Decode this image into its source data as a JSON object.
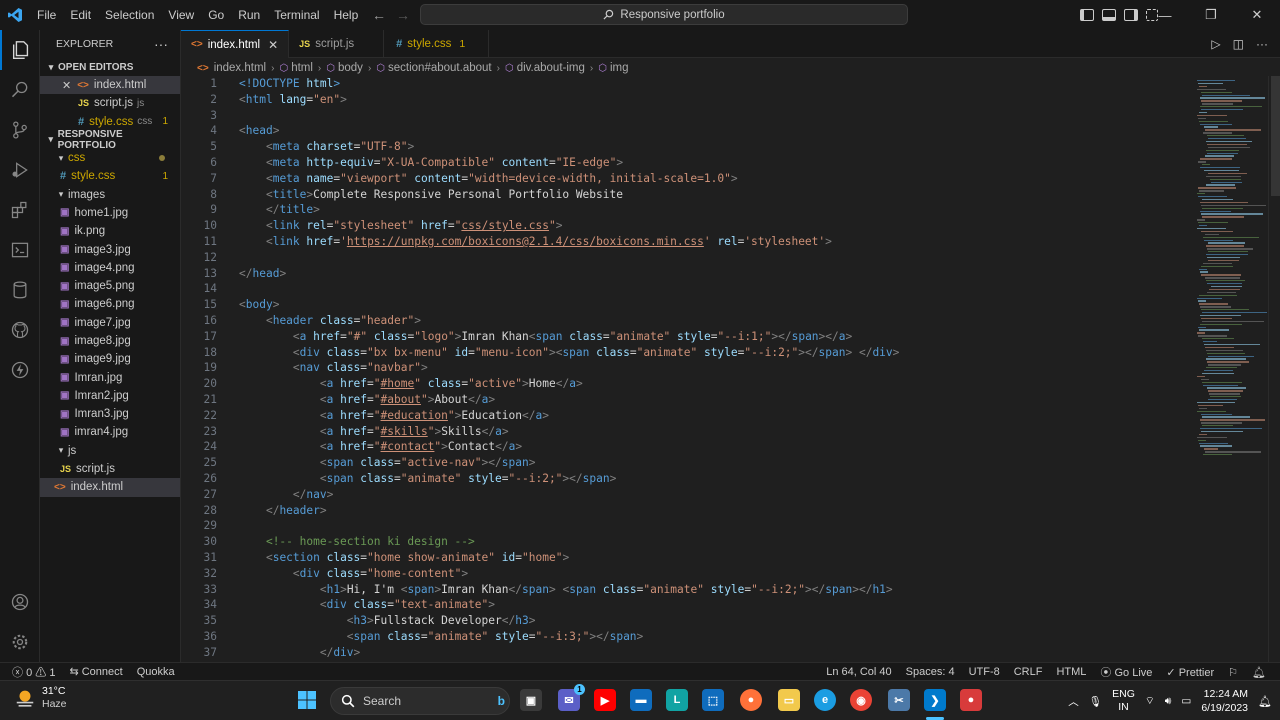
{
  "titlebar": {
    "menu": [
      "File",
      "Edit",
      "Selection",
      "View",
      "Go",
      "Run",
      "Terminal",
      "Help"
    ],
    "search_text": "Responsive portfolio"
  },
  "sidebar": {
    "title": "EXPLORER",
    "open_editors_label": "OPEN EDITORS",
    "open_editors": [
      {
        "name": "index.html",
        "kind": "html",
        "hint": ""
      },
      {
        "name": "script.js",
        "kind": "js",
        "hint": "js"
      },
      {
        "name": "style.css",
        "kind": "css",
        "hint": "css",
        "badge": "1"
      }
    ],
    "project_label": "RESPONSIVE PORTFOLIO",
    "folders": {
      "css": "css",
      "images": "images",
      "js": "js"
    },
    "css_files": [
      {
        "name": "style.css",
        "badge": "1"
      }
    ],
    "image_files": [
      "home1.jpg",
      "ik.png",
      "image3.jpg",
      "image4.png",
      "image5.png",
      "image6.png",
      "image7.jpg",
      "image8.jpg",
      "image9.jpg",
      "Imran.jpg",
      "Imran2.jpg",
      "Imran3.jpg",
      "imran4.jpg"
    ],
    "js_files": [
      "script.js"
    ],
    "root_files": [
      "index.html"
    ]
  },
  "tabs": [
    {
      "label": "index.html",
      "kind": "html",
      "active": true
    },
    {
      "label": "script.js",
      "kind": "js",
      "active": false
    },
    {
      "label": "style.css",
      "kind": "css",
      "active": false,
      "badge": "1"
    }
  ],
  "breadcrumb": [
    "index.html",
    "html",
    "body",
    "section#about.about",
    "div.about-img",
    "img"
  ],
  "code_lines": [
    {
      "n": 1,
      "i": 0,
      "h": "<span class=\"t\">&lt;!DOCTYPE</span> <span class=\"a\">html</span><span class=\"t\">&gt;</span>"
    },
    {
      "n": 2,
      "i": 0,
      "h": "<span class=\"p\">&lt;</span><span class=\"t\">html</span> <span class=\"a\">lang</span>=<span class=\"s\">\"en\"</span><span class=\"p\">&gt;</span>"
    },
    {
      "n": 3,
      "i": 0,
      "h": ""
    },
    {
      "n": 4,
      "i": 0,
      "h": "<span class=\"p\">&lt;</span><span class=\"t\">head</span><span class=\"p\">&gt;</span>"
    },
    {
      "n": 5,
      "i": 1,
      "h": "<span class=\"p\">&lt;</span><span class=\"t\">meta</span> <span class=\"a\">charset</span>=<span class=\"s\">\"UTF-8\"</span><span class=\"p\">&gt;</span>"
    },
    {
      "n": 6,
      "i": 1,
      "h": "<span class=\"p\">&lt;</span><span class=\"t\">meta</span> <span class=\"a\">http-equiv</span>=<span class=\"s\">\"X-UA-Compatible\"</span> <span class=\"a\">content</span>=<span class=\"s\">\"IE-edge\"</span><span class=\"p\">&gt;</span>"
    },
    {
      "n": 7,
      "i": 1,
      "h": "<span class=\"p\">&lt;</span><span class=\"t\">meta</span> <span class=\"a\">name</span>=<span class=\"s\">\"viewport\"</span> <span class=\"a\">content</span>=<span class=\"s\">\"width=device-width, initial-scale=1.0\"</span><span class=\"p\">&gt;</span>"
    },
    {
      "n": 8,
      "i": 1,
      "h": "<span class=\"p\">&lt;</span><span class=\"t\">title</span><span class=\"p\">&gt;</span><span class=\"txt\">Complete Responsive Personal Portfolio Website</span>"
    },
    {
      "n": 9,
      "i": 1,
      "h": "<span class=\"p\">&lt;/</span><span class=\"t\">title</span><span class=\"p\">&gt;</span>"
    },
    {
      "n": 10,
      "i": 1,
      "h": "<span class=\"p\">&lt;</span><span class=\"t\">link</span> <span class=\"a\">rel</span>=<span class=\"s\">\"stylesheet\"</span> <span class=\"a\">href</span>=<span class=\"s\">\"<span class=\"u\">css/style.css</span>\"</span><span class=\"p\">&gt;</span>"
    },
    {
      "n": 11,
      "i": 1,
      "h": "<span class=\"p\">&lt;</span><span class=\"t\">link</span> <span class=\"a\">href</span>=<span class=\"s\">'<span class=\"u\">https://unpkg.com/boxicons@2.1.4/css/boxicons.min.css</span>'</span> <span class=\"a\">rel</span>=<span class=\"s\">'stylesheet'</span><span class=\"p\">&gt;</span>"
    },
    {
      "n": 12,
      "i": 0,
      "h": ""
    },
    {
      "n": 13,
      "i": 0,
      "h": "<span class=\"p\">&lt;/</span><span class=\"t\">head</span><span class=\"p\">&gt;</span>"
    },
    {
      "n": 14,
      "i": 0,
      "h": ""
    },
    {
      "n": 15,
      "i": 0,
      "h": "<span class=\"p\">&lt;</span><span class=\"t\">body</span><span class=\"p\">&gt;</span>"
    },
    {
      "n": 16,
      "i": 1,
      "h": "<span class=\"p\">&lt;</span><span class=\"t\">header</span> <span class=\"a\">class</span>=<span class=\"s\">\"header\"</span><span class=\"p\">&gt;</span>"
    },
    {
      "n": 17,
      "i": 2,
      "h": "<span class=\"p\">&lt;</span><span class=\"t\">a</span> <span class=\"a\">href</span>=<span class=\"s\">\"#\"</span> <span class=\"a\">class</span>=<span class=\"s\">\"logo\"</span><span class=\"p\">&gt;</span><span class=\"txt\">Imran Khan</span><span class=\"p\">&lt;</span><span class=\"t\">span</span> <span class=\"a\">class</span>=<span class=\"s\">\"animate\"</span> <span class=\"a\">style</span>=<span class=\"s\">\"--i:1;\"</span><span class=\"p\">&gt;&lt;/</span><span class=\"t\">span</span><span class=\"p\">&gt;&lt;/</span><span class=\"t\">a</span><span class=\"p\">&gt;</span>"
    },
    {
      "n": 18,
      "i": 2,
      "h": "<span class=\"p\">&lt;</span><span class=\"t\">div</span> <span class=\"a\">class</span>=<span class=\"s\">\"bx bx-menu\"</span> <span class=\"a\">id</span>=<span class=\"s\">\"menu-icon\"</span><span class=\"p\">&gt;&lt;</span><span class=\"t\">span</span> <span class=\"a\">class</span>=<span class=\"s\">\"animate\"</span> <span class=\"a\">style</span>=<span class=\"s\">\"--i:2;\"</span><span class=\"p\">&gt;&lt;/</span><span class=\"t\">span</span><span class=\"p\">&gt;</span> <span class=\"p\">&lt;/</span><span class=\"t\">div</span><span class=\"p\">&gt;</span>"
    },
    {
      "n": 19,
      "i": 2,
      "h": "<span class=\"p\">&lt;</span><span class=\"t\">nav</span> <span class=\"a\">class</span>=<span class=\"s\">\"navbar\"</span><span class=\"p\">&gt;</span>"
    },
    {
      "n": 20,
      "i": 3,
      "h": "<span class=\"p\">&lt;</span><span class=\"t\">a</span> <span class=\"a\">href</span>=<span class=\"s\">\"<span class=\"u\">#home</span>\"</span> <span class=\"a\">class</span>=<span class=\"s\">\"active\"</span><span class=\"p\">&gt;</span><span class=\"txt\">Home</span><span class=\"p\">&lt;/</span><span class=\"t\">a</span><span class=\"p\">&gt;</span>"
    },
    {
      "n": 21,
      "i": 3,
      "h": "<span class=\"p\">&lt;</span><span class=\"t\">a</span> <span class=\"a\">href</span>=<span class=\"s\">\"<span class=\"u\">#about</span>\"</span><span class=\"p\">&gt;</span><span class=\"txt\">About</span><span class=\"p\">&lt;/</span><span class=\"t\">a</span><span class=\"p\">&gt;</span>"
    },
    {
      "n": 22,
      "i": 3,
      "h": "<span class=\"p\">&lt;</span><span class=\"t\">a</span> <span class=\"a\">href</span>=<span class=\"s\">\"<span class=\"u\">#education</span>\"</span><span class=\"p\">&gt;</span><span class=\"txt\">Education</span><span class=\"p\">&lt;/</span><span class=\"t\">a</span><span class=\"p\">&gt;</span>"
    },
    {
      "n": 23,
      "i": 3,
      "h": "<span class=\"p\">&lt;</span><span class=\"t\">a</span> <span class=\"a\">href</span>=<span class=\"s\">\"<span class=\"u\">#skills</span>\"</span><span class=\"p\">&gt;</span><span class=\"txt\">Skills</span><span class=\"p\">&lt;/</span><span class=\"t\">a</span><span class=\"p\">&gt;</span>"
    },
    {
      "n": 24,
      "i": 3,
      "h": "<span class=\"p\">&lt;</span><span class=\"t\">a</span> <span class=\"a\">href</span>=<span class=\"s\">\"<span class=\"u\">#contact</span>\"</span><span class=\"p\">&gt;</span><span class=\"txt\">Contact</span><span class=\"p\">&lt;/</span><span class=\"t\">a</span><span class=\"p\">&gt;</span>"
    },
    {
      "n": 25,
      "i": 3,
      "h": "<span class=\"p\">&lt;</span><span class=\"t\">span</span> <span class=\"a\">class</span>=<span class=\"s\">\"active-nav\"</span><span class=\"p\">&gt;&lt;/</span><span class=\"t\">span</span><span class=\"p\">&gt;</span>"
    },
    {
      "n": 26,
      "i": 3,
      "h": "<span class=\"p\">&lt;</span><span class=\"t\">span</span> <span class=\"a\">class</span>=<span class=\"s\">\"animate\"</span> <span class=\"a\">style</span>=<span class=\"s\">\"--i:2;\"</span><span class=\"p\">&gt;&lt;/</span><span class=\"t\">span</span><span class=\"p\">&gt;</span>"
    },
    {
      "n": 27,
      "i": 2,
      "h": "<span class=\"p\">&lt;/</span><span class=\"t\">nav</span><span class=\"p\">&gt;</span>"
    },
    {
      "n": 28,
      "i": 1,
      "h": "<span class=\"p\">&lt;/</span><span class=\"t\">header</span><span class=\"p\">&gt;</span>"
    },
    {
      "n": 29,
      "i": 0,
      "h": ""
    },
    {
      "n": 30,
      "i": 1,
      "h": "<span class=\"c\">&lt;!-- home-section ki design --&gt;</span>"
    },
    {
      "n": 31,
      "i": 1,
      "h": "<span class=\"p\">&lt;</span><span class=\"t\">section</span> <span class=\"a\">class</span>=<span class=\"s\">\"home show-animate\"</span> <span class=\"a\">id</span>=<span class=\"s\">\"home\"</span><span class=\"p\">&gt;</span>"
    },
    {
      "n": 32,
      "i": 2,
      "h": "<span class=\"p\">&lt;</span><span class=\"t\">div</span> <span class=\"a\">class</span>=<span class=\"s\">\"home-content\"</span><span class=\"p\">&gt;</span>"
    },
    {
      "n": 33,
      "i": 3,
      "h": "<span class=\"p\">&lt;</span><span class=\"t\">h1</span><span class=\"p\">&gt;</span><span class=\"txt\">Hi, I'm </span><span class=\"p\">&lt;</span><span class=\"t\">span</span><span class=\"p\">&gt;</span><span class=\"txt\">Imran Khan</span><span class=\"p\">&lt;/</span><span class=\"t\">span</span><span class=\"p\">&gt;</span> <span class=\"p\">&lt;</span><span class=\"t\">span</span> <span class=\"a\">class</span>=<span class=\"s\">\"animate\"</span> <span class=\"a\">style</span>=<span class=\"s\">\"--i:2;\"</span><span class=\"p\">&gt;&lt;/</span><span class=\"t\">span</span><span class=\"p\">&gt;&lt;/</span><span class=\"t\">h1</span><span class=\"p\">&gt;</span>"
    },
    {
      "n": 34,
      "i": 3,
      "h": "<span class=\"p\">&lt;</span><span class=\"t\">div</span> <span class=\"a\">class</span>=<span class=\"s\">\"text-animate\"</span><span class=\"p\">&gt;</span>"
    },
    {
      "n": 35,
      "i": 4,
      "h": "<span class=\"p\">&lt;</span><span class=\"t\">h3</span><span class=\"p\">&gt;</span><span class=\"txt\">Fullstack Developer</span><span class=\"p\">&lt;/</span><span class=\"t\">h3</span><span class=\"p\">&gt;</span>"
    },
    {
      "n": 36,
      "i": 4,
      "h": "<span class=\"p\">&lt;</span><span class=\"t\">span</span> <span class=\"a\">class</span>=<span class=\"s\">\"animate\"</span> <span class=\"a\">style</span>=<span class=\"s\">\"--i:3;\"</span><span class=\"p\">&gt;&lt;/</span><span class=\"t\">span</span><span class=\"p\">&gt;</span>"
    },
    {
      "n": 37,
      "i": 3,
      "h": "<span class=\"p\">&lt;/</span><span class=\"t\">div</span><span class=\"p\">&gt;</span>"
    }
  ],
  "statusbar": {
    "errors": "0",
    "warnings": "1",
    "connect": "Connect",
    "quokka": "Quokka",
    "position": "Ln 64, Col 40",
    "spaces": "Spaces: 4",
    "encoding": "UTF-8",
    "eol": "CRLF",
    "language": "HTML",
    "golive": "Go Live",
    "prettier": "Prettier"
  },
  "taskbar": {
    "temperature": "31°C",
    "condition": "Haze",
    "search_label": "Search",
    "lang_top": "ENG",
    "lang_bottom": "IN",
    "time": "12:24 AM",
    "date": "6/19/2023",
    "chat_badge": "1"
  },
  "colors": {
    "accent": "#0078d4",
    "editor_bg": "#1f1f1f",
    "chrome_bg": "#181818",
    "warning": "#cca700"
  }
}
